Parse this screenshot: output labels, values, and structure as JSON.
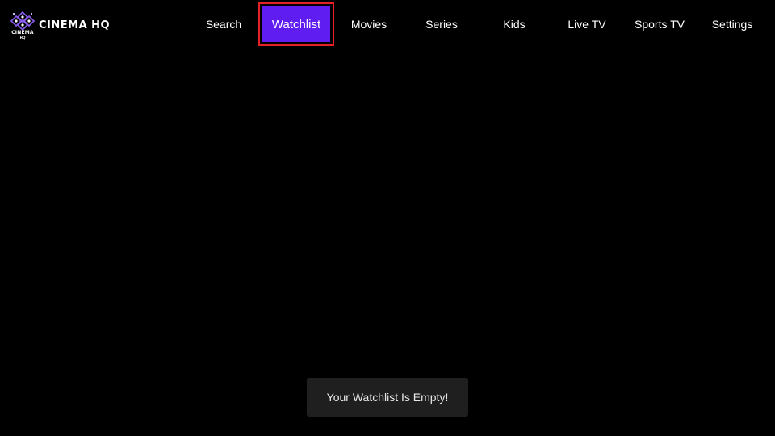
{
  "app": {
    "logo_title": "CINEMA HQ",
    "logo_small_line1": "CINEMA",
    "logo_small_line2": "HQ"
  },
  "nav": {
    "items": [
      {
        "label": "Search",
        "active": false
      },
      {
        "label": "Watchlist",
        "active": true
      },
      {
        "label": "Movies",
        "active": false
      },
      {
        "label": "Series",
        "active": false
      },
      {
        "label": "Kids",
        "active": false
      },
      {
        "label": "Live TV",
        "active": false
      },
      {
        "label": "Sports TV",
        "active": false
      },
      {
        "label": "Settings",
        "active": false
      }
    ]
  },
  "toast": {
    "message": "Your Watchlist Is Empty!"
  },
  "colors": {
    "background": "#000000",
    "accent": "#5f1df2",
    "focus_border": "#e5202a",
    "toast_bg": "#1f1f1f",
    "logo_purple": "#8a5cf0"
  },
  "icons": {
    "logo": "cinema-hq-logo-icon"
  }
}
